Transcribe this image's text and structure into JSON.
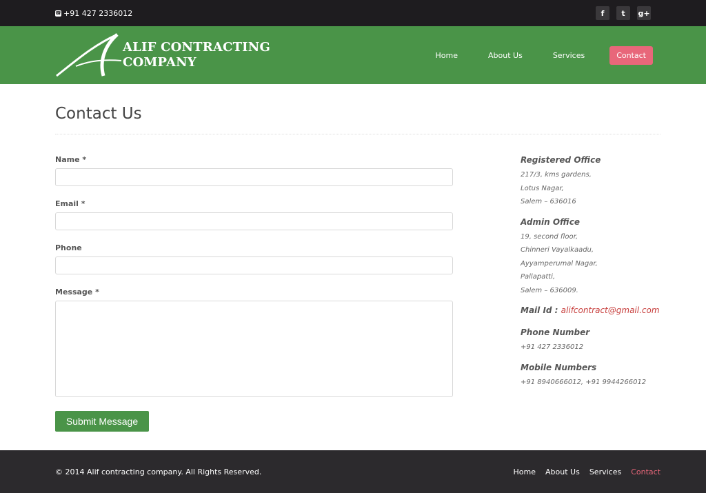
{
  "topbar": {
    "phone": "+91 427 2336012",
    "socials": [
      {
        "icon": "facebook-icon",
        "glyph": "f"
      },
      {
        "icon": "twitter-icon",
        "glyph": "t"
      },
      {
        "icon": "googleplus-icon",
        "glyph": "g+"
      }
    ]
  },
  "header": {
    "logo_line1": "ALIF CONTRACTING",
    "logo_line2": "COMPANY",
    "nav": [
      "Home",
      "About Us",
      "Services",
      "Contact"
    ]
  },
  "main": {
    "title": "Contact Us",
    "form": {
      "name_label": "Name *",
      "email_label": "Email *",
      "phone_label": "Phone",
      "message_label": "Message *",
      "submit_label": "Submit Message"
    },
    "info": {
      "registered_title": "Registered Office",
      "registered_lines": [
        "217/3, kms gardens,",
        "Lotus Nagar,",
        "Salem – 636016"
      ],
      "admin_title": "Admin Office",
      "admin_lines": [
        "19, second floor,",
        "Chinneri Vayalkaadu,",
        "Ayyamperumal Nagar,",
        "Pallapatti,",
        "Salem – 636009."
      ],
      "mail_label": "Mail Id :",
      "mail_value": "alifcontract@gmail.com",
      "phone_title": "Phone Number",
      "phone_value": "+91 427 2336012",
      "mobile_title": "Mobile Numbers",
      "mobile_value": "+91 8940666012, +91 9944266012"
    }
  },
  "footer": {
    "copyright": "© 2014 Alif contracting company. All Rights Reserved.",
    "nav": [
      "Home",
      "About Us",
      "Services",
      "Contact"
    ]
  },
  "colors": {
    "header_green": "#4a9448",
    "accent_pink": "#e8677a",
    "dark": "#1e1c1f",
    "link_red": "#c8413f"
  }
}
